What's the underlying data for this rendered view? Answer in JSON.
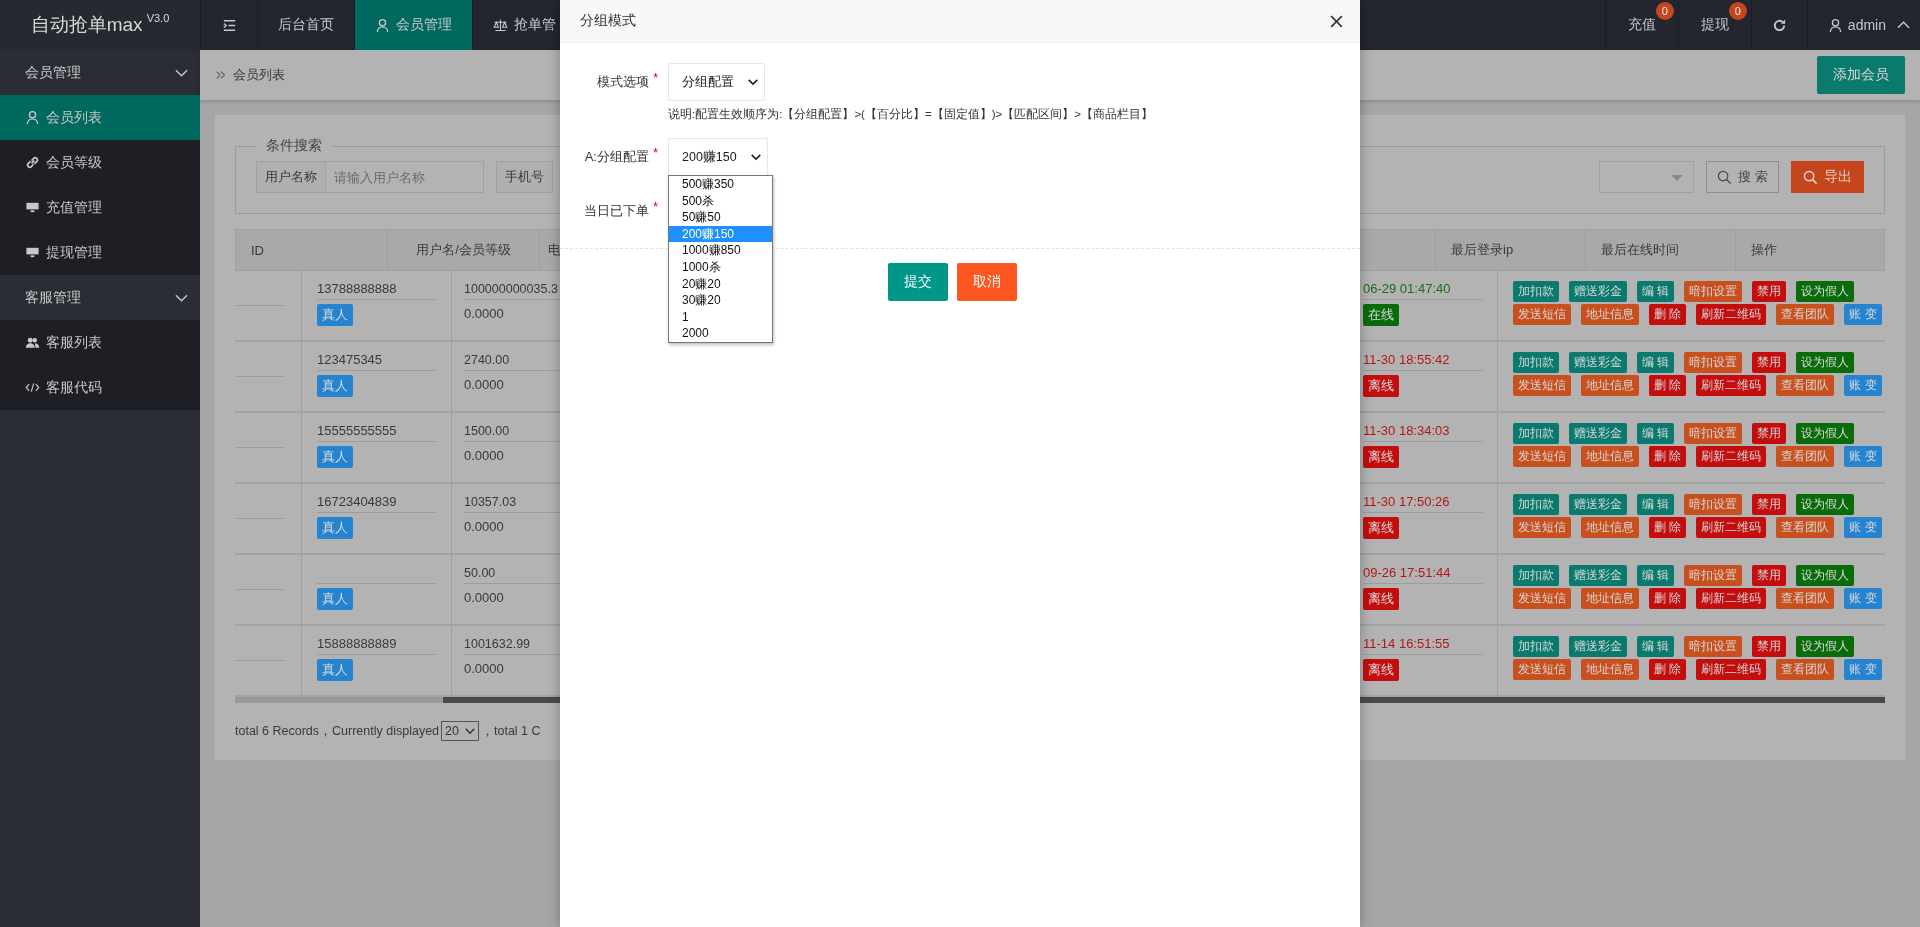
{
  "top_bar": {
    "logo": "自动抢单max",
    "version": "V3.0",
    "nav": [
      {
        "label": "后台首页",
        "selected": false
      },
      {
        "label": "会员管理",
        "selected": true
      },
      {
        "label": "抢单管",
        "selected": false
      }
    ],
    "counters": [
      {
        "label": "充值",
        "badge": "0"
      },
      {
        "label": "提现",
        "badge": "0"
      }
    ],
    "user": "admin"
  },
  "sidebar": {
    "groups": [
      {
        "label": "会员管理",
        "expanded": true,
        "items": [
          {
            "label": "会员列表",
            "selected": true
          },
          {
            "label": "会员等级",
            "selected": false
          },
          {
            "label": "充值管理",
            "selected": false
          },
          {
            "label": "提现管理",
            "selected": false
          }
        ]
      },
      {
        "label": "客服管理",
        "expanded": true,
        "items": [
          {
            "label": "客服列表",
            "selected": false
          },
          {
            "label": "客服代码",
            "selected": false
          }
        ]
      }
    ]
  },
  "breadcrumb": "会员列表",
  "add_button": "添加会员",
  "search": {
    "legend": "条件搜索",
    "fields": [
      {
        "label": "用户名称",
        "placeholder": "请输入用户名称"
      },
      {
        "label": "手机号"
      }
    ],
    "search_button": "搜 索",
    "export_button": "导出"
  },
  "table": {
    "columns_left": [
      "ID",
      "用户名/会员等级",
      "电"
    ],
    "columns_right": [
      "最后登录ip",
      "最后在线时间",
      "操作"
    ],
    "rows": [
      {
        "username": "13788888888",
        "level": "真人",
        "balance": "100000000035.3",
        "balance_2": "0.0000",
        "last_online": "06-29 01:47:40",
        "status": "在线",
        "online": true,
        "actions": [
          {
            "label": "加扣款",
            "color": "#0b7a6e"
          },
          {
            "label": "赠送彩金",
            "color": "#0b7a6e"
          },
          {
            "label": "编 辑",
            "color": "#0b7a6e"
          },
          {
            "label": "暗扣设置",
            "color": "#c8501f"
          },
          {
            "label": "禁用",
            "color": "#c40d0d"
          },
          {
            "label": "设为假人",
            "color": "#0a6b0a"
          },
          {
            "label": "发送短信",
            "color": "#c8501f"
          },
          {
            "label": "地址信息",
            "color": "#c8501f"
          },
          {
            "label": "删 除",
            "color": "#c40d0d"
          },
          {
            "label": "刷新二维码",
            "color": "#c40d0d"
          },
          {
            "label": "查看团队",
            "color": "#c8501f"
          },
          {
            "label": "账 变",
            "color": "#2583d0"
          }
        ]
      },
      {
        "username": "123475345",
        "level": "真人",
        "balance": "2740.00",
        "balance_2": "0.0000",
        "last_online": "11-30 18:55:42",
        "status": "离线",
        "online": false,
        "actions": [
          {
            "label": "加扣款",
            "color": "#0b7a6e"
          },
          {
            "label": "赠送彩金",
            "color": "#0b7a6e"
          },
          {
            "label": "编 辑",
            "color": "#0b7a6e"
          },
          {
            "label": "暗扣设置",
            "color": "#c8501f"
          },
          {
            "label": "禁用",
            "color": "#c40d0d"
          },
          {
            "label": "设为假人",
            "color": "#0a6b0a"
          },
          {
            "label": "发送短信",
            "color": "#c8501f"
          },
          {
            "label": "地址信息",
            "color": "#c8501f"
          },
          {
            "label": "删 除",
            "color": "#c40d0d"
          },
          {
            "label": "刷新二维码",
            "color": "#c40d0d"
          },
          {
            "label": "查看团队",
            "color": "#c8501f"
          },
          {
            "label": "账 变",
            "color": "#2583d0"
          }
        ]
      },
      {
        "username": "15555555555",
        "level": "真人",
        "balance": "1500.00",
        "balance_2": "0.0000",
        "last_online": "11-30 18:34:03",
        "status": "离线",
        "online": false,
        "actions": [
          {
            "label": "加扣款",
            "color": "#0b7a6e"
          },
          {
            "label": "赠送彩金",
            "color": "#0b7a6e"
          },
          {
            "label": "编 辑",
            "color": "#0b7a6e"
          },
          {
            "label": "暗扣设置",
            "color": "#c8501f"
          },
          {
            "label": "禁用",
            "color": "#c40d0d"
          },
          {
            "label": "设为假人",
            "color": "#0a6b0a"
          },
          {
            "label": "发送短信",
            "color": "#c8501f"
          },
          {
            "label": "地址信息",
            "color": "#c8501f"
          },
          {
            "label": "删 除",
            "color": "#c40d0d"
          },
          {
            "label": "刷新二维码",
            "color": "#c40d0d"
          },
          {
            "label": "查看团队",
            "color": "#c8501f"
          },
          {
            "label": "账 变",
            "color": "#2583d0"
          }
        ]
      },
      {
        "username": "16723404839",
        "level": "真人",
        "balance": "10357.03",
        "balance_2": "0.0000",
        "last_online": "11-30 17:50:26",
        "status": "离线",
        "online": false,
        "actions": [
          {
            "label": "加扣款",
            "color": "#0b7a6e"
          },
          {
            "label": "赠送彩金",
            "color": "#0b7a6e"
          },
          {
            "label": "编 辑",
            "color": "#0b7a6e"
          },
          {
            "label": "暗扣设置",
            "color": "#c8501f"
          },
          {
            "label": "禁用",
            "color": "#c40d0d"
          },
          {
            "label": "设为假人",
            "color": "#0a6b0a"
          },
          {
            "label": "发送短信",
            "color": "#c8501f"
          },
          {
            "label": "地址信息",
            "color": "#c8501f"
          },
          {
            "label": "删 除",
            "color": "#c40d0d"
          },
          {
            "label": "刷新二维码",
            "color": "#c40d0d"
          },
          {
            "label": "查看团队",
            "color": "#c8501f"
          },
          {
            "label": "账 变",
            "color": "#2583d0"
          }
        ]
      },
      {
        "level": "真人",
        "balance": "50.00",
        "balance_2": "0.0000",
        "last_online": "09-26 17:51:44",
        "status": "离线",
        "online": false,
        "actions": [
          {
            "label": "加扣款",
            "color": "#0b7a6e"
          },
          {
            "label": "赠送彩金",
            "color": "#0b7a6e"
          },
          {
            "label": "编 辑",
            "color": "#0b7a6e"
          },
          {
            "label": "暗扣设置",
            "color": "#c8501f"
          },
          {
            "label": "禁用",
            "color": "#c40d0d"
          },
          {
            "label": "设为假人",
            "color": "#0a6b0a"
          },
          {
            "label": "发送短信",
            "color": "#c8501f"
          },
          {
            "label": "地址信息",
            "color": "#c8501f"
          },
          {
            "label": "删 除",
            "color": "#c40d0d"
          },
          {
            "label": "刷新二维码",
            "color": "#c40d0d"
          },
          {
            "label": "查看团队",
            "color": "#c8501f"
          },
          {
            "label": "账 变",
            "color": "#2583d0"
          }
        ]
      },
      {
        "username": "15888888889",
        "level": "真人",
        "balance": "1001632.99",
        "balance_2": "0.0000",
        "last_online": "11-14 16:51:55",
        "status": "离线",
        "online": false,
        "actions": [
          {
            "label": "加扣款",
            "color": "#0b7a6e"
          },
          {
            "label": "赠送彩金",
            "color": "#0b7a6e"
          },
          {
            "label": "编 辑",
            "color": "#0b7a6e"
          },
          {
            "label": "暗扣设置",
            "color": "#c8501f"
          },
          {
            "label": "禁用",
            "color": "#c40d0d"
          },
          {
            "label": "设为假人",
            "color": "#0a6b0a"
          },
          {
            "label": "发送短信",
            "color": "#c8501f"
          },
          {
            "label": "地址信息",
            "color": "#c8501f"
          },
          {
            "label": "删 除",
            "color": "#c40d0d"
          },
          {
            "label": "刷新二维码",
            "color": "#c40d0d"
          },
          {
            "label": "查看团队",
            "color": "#c8501f"
          },
          {
            "label": "账 变",
            "color": "#2583d0"
          }
        ]
      }
    ]
  },
  "pagination": {
    "prefix": "total 6 Records，Currently displayed",
    "page_size": "20",
    "suffix": "，total 1 C"
  },
  "modal": {
    "title": "分组模式",
    "note": "说明:配置生效顺序为:【分组配置】>(【百分比】=【固定值】)>【匹配区间】>【商品栏目】",
    "fields": [
      {
        "label": "模式选项",
        "mark": "*",
        "kind": "select",
        "value": "分组配置"
      },
      {
        "label": "A:分组配置",
        "mark": "*",
        "kind": "select",
        "value": "200赚150",
        "options": [
          {
            "label": "500赚350",
            "selected": false
          },
          {
            "label": "500杀",
            "selected": false
          },
          {
            "label": "50赚50",
            "selected": false
          },
          {
            "label": "200赚150",
            "selected": true
          },
          {
            "label": "1000赚850",
            "selected": false
          },
          {
            "label": "1000杀",
            "selected": false
          },
          {
            "label": "20赚20",
            "selected": false
          },
          {
            "label": "30赚20",
            "selected": false
          },
          {
            "label": "1",
            "selected": false
          },
          {
            "label": "2000",
            "selected": false
          }
        ]
      },
      {
        "label": "当日已下单",
        "mark": "*",
        "kind": "covered"
      }
    ],
    "submit": "提交",
    "cancel": "取消"
  }
}
